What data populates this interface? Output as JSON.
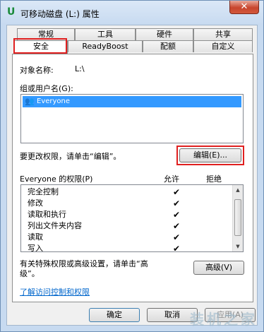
{
  "window": {
    "title": "可移动磁盘 (L:) 属性",
    "close_symbol": "✕"
  },
  "tabs_row1": [
    "常规",
    "工具",
    "硬件",
    "共享"
  ],
  "tabs_row2": [
    "安全",
    "ReadyBoost",
    "配额",
    "自定义"
  ],
  "security": {
    "object_name_label": "对象名称:",
    "object_name_value": "L:\\",
    "group_label": "组或用户名(G):",
    "group_selected": "Everyone",
    "change_hint": "要更改权限，请单击“编辑”。",
    "edit_button": "编辑(E)...",
    "permissions_for": "Everyone 的权限(P)",
    "allow_header": "允许",
    "deny_header": "拒绝",
    "permissions": [
      {
        "name": "完全控制",
        "allow": "✔"
      },
      {
        "name": "修改",
        "allow": "✔"
      },
      {
        "name": "读取和执行",
        "allow": "✔"
      },
      {
        "name": "列出文件夹内容",
        "allow": "✔"
      },
      {
        "name": "读取",
        "allow": "✔"
      },
      {
        "name": "写入",
        "allow": "✔"
      }
    ],
    "special_hint_line1": "有关特殊权限或高级设置，请单击“高",
    "special_hint_line2": "级”。",
    "advanced_button": "高级(V)",
    "access_link": "了解访问控制和权限"
  },
  "footer": {
    "ok": "确定",
    "cancel": "取消",
    "apply": "应用(A)"
  },
  "watermark": "装机之家",
  "highlight_color": "#e02020"
}
